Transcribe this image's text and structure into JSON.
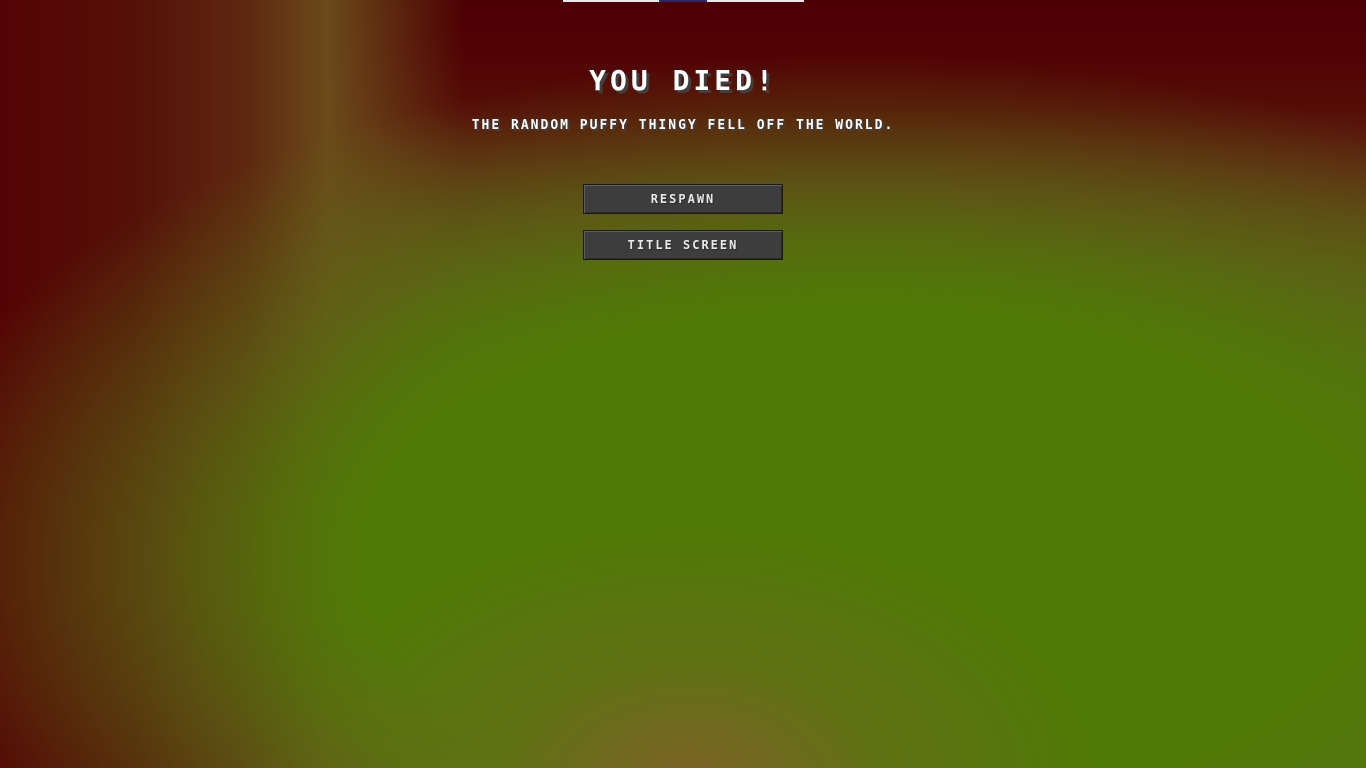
{
  "death_screen": {
    "title": "You Died!",
    "message": "The random puffy thingy fell off the world.",
    "buttons": {
      "respawn": "Respawn",
      "title_screen": "Title Screen"
    }
  },
  "colors": {
    "background_top": "#4c0003",
    "background_bottom": "#4f7a06",
    "button_bg": "#3d3d3d",
    "text": "#ffffff"
  }
}
